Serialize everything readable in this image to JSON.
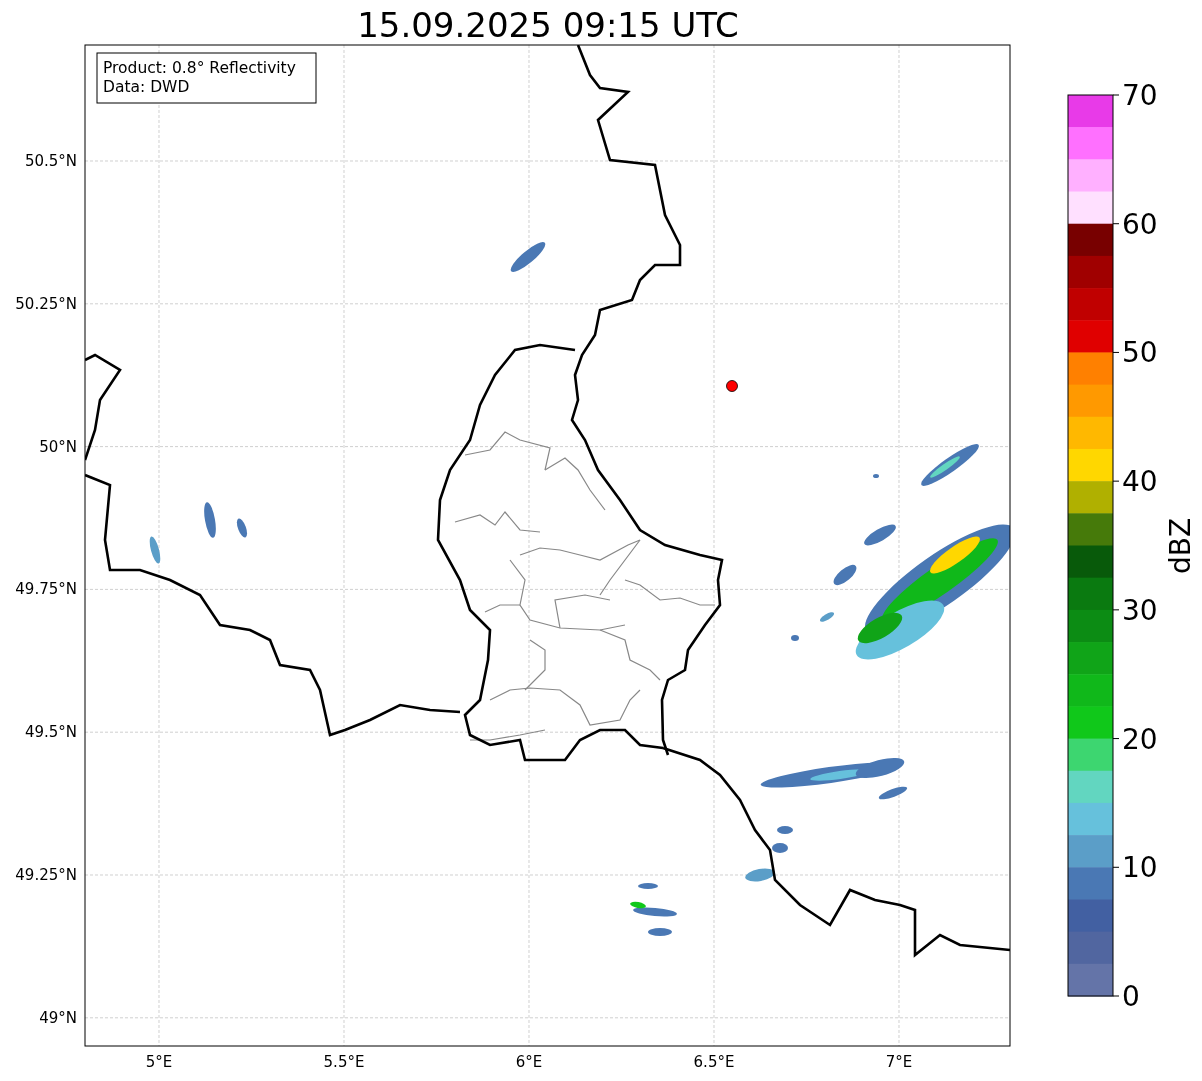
{
  "title": "15.09.2025 09:15 UTC",
  "info_box": [
    "Product: 0.8° Reflectivity",
    "Data: DWD"
  ],
  "lat_ticks": [
    "50.5°N",
    "50.25°N",
    "50°N",
    "49.75°N",
    "49.5°N",
    "49.25°N",
    "49°N"
  ],
  "lon_ticks": [
    "5°E",
    "5.5°E",
    "6°E",
    "6.5°E",
    "7°E"
  ],
  "colorbar": {
    "label": "dBZ",
    "ticks": [
      "70",
      "60",
      "50",
      "40",
      "30",
      "20",
      "10",
      "0"
    ],
    "bands": [
      {
        "color": "#e83ae8"
      },
      {
        "color": "#ff70ff"
      },
      {
        "color": "#ffb0ff"
      },
      {
        "color": "#ffe0ff"
      },
      {
        "color": "#780000"
      },
      {
        "color": "#a00000"
      },
      {
        "color": "#c00000"
      },
      {
        "color": "#e00000"
      },
      {
        "color": "#ff8000"
      },
      {
        "color": "#ff9900"
      },
      {
        "color": "#ffb800"
      },
      {
        "color": "#ffd700"
      },
      {
        "color": "#b0b000"
      },
      {
        "color": "#467a0a"
      },
      {
        "color": "#085a0a"
      },
      {
        "color": "#0a7a10"
      },
      {
        "color": "#0c8c14"
      },
      {
        "color": "#10a418"
      },
      {
        "color": "#10b81a"
      },
      {
        "color": "#10c81a"
      },
      {
        "color": "#3dd670"
      },
      {
        "color": "#62d6c0"
      },
      {
        "color": "#66c1dc"
      },
      {
        "color": "#5b9ec8"
      },
      {
        "color": "#4a78b4"
      },
      {
        "color": "#4260a2"
      },
      {
        "color": "#5166a0"
      },
      {
        "color": "#6474a8"
      }
    ]
  }
}
